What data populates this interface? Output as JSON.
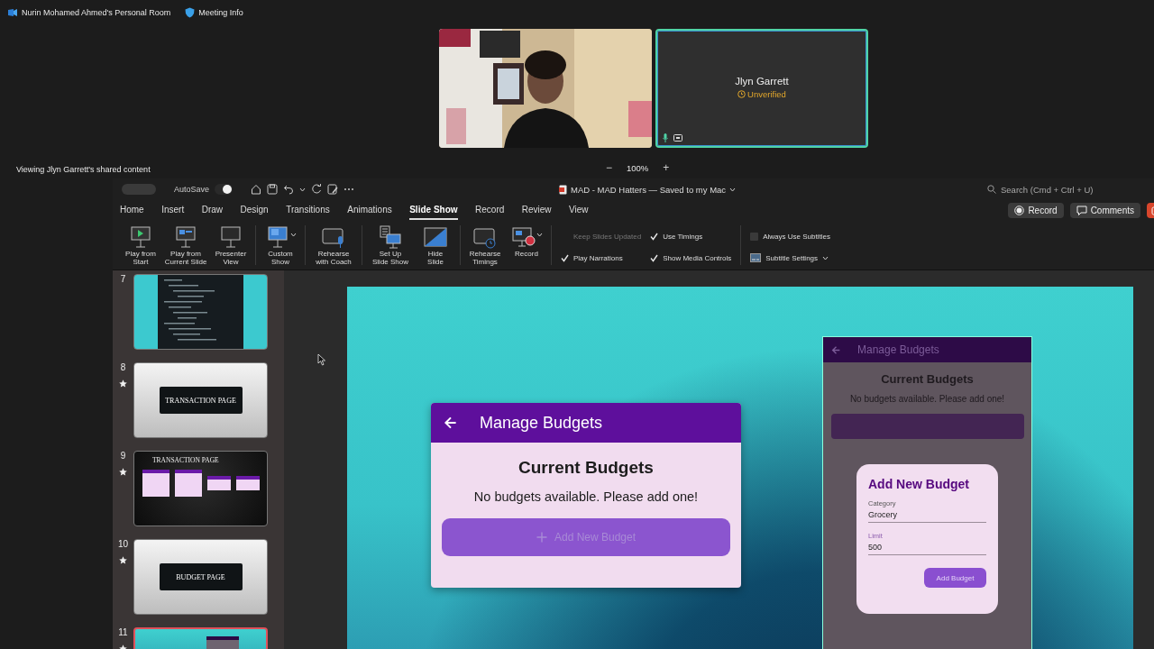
{
  "meeting": {
    "room": "Nurin Mohamed Ahmed's Personal Room",
    "info": "Meeting Info"
  },
  "participants": [
    {
      "kind": "video",
      "speaking": false
    },
    {
      "kind": "tile",
      "name": "Jlyn Garrett",
      "status": "Unverified",
      "speaking": true
    }
  ],
  "share_banner": "Viewing Jlyn Garrett's shared content",
  "zoom": {
    "minus": "−",
    "value": "100%",
    "plus": "+"
  },
  "app": {
    "autosave": {
      "label": "AutoSave",
      "on": true
    },
    "document_title": "MAD - MAD Hatters — Saved to my Mac",
    "search_placeholder": "Search (Cmd + Ctrl + U)",
    "tabs": [
      {
        "label": "Home",
        "selected": false
      },
      {
        "label": "Insert",
        "selected": false
      },
      {
        "label": "Draw",
        "selected": false
      },
      {
        "label": "Design",
        "selected": false
      },
      {
        "label": "Transitions",
        "selected": false
      },
      {
        "label": "Animations",
        "selected": false
      },
      {
        "label": "Slide Show",
        "selected": true
      },
      {
        "label": "Record",
        "selected": false
      },
      {
        "label": "Review",
        "selected": false
      },
      {
        "label": "View",
        "selected": false
      }
    ],
    "header_buttons": [
      {
        "kind": "record",
        "label": "Record"
      },
      {
        "kind": "comments",
        "label": "Comments"
      },
      {
        "kind": "share"
      }
    ],
    "ribbon": {
      "groups": [
        {
          "buttons": [
            {
              "kind": "play_start",
              "label": "Play from\nStart",
              "dropdown": false
            },
            {
              "kind": "play_current",
              "label": "Play from\nCurrent Slide",
              "dropdown": false
            },
            {
              "kind": "presenter",
              "label": "Presenter\nView",
              "dropdown": false
            }
          ]
        },
        {
          "buttons": [
            {
              "kind": "custom_show",
              "label": "Custom\nShow",
              "dropdown": true
            }
          ]
        },
        {
          "buttons": [
            {
              "kind": "coach",
              "label": "Rehearse\nwith Coach",
              "dropdown": false
            }
          ]
        },
        {
          "buttons": [
            {
              "kind": "setup",
              "label": "Set Up\nSlide Show",
              "dropdown": false
            },
            {
              "kind": "hide",
              "label": "Hide\nSlide",
              "dropdown": false
            }
          ]
        },
        {
          "buttons": [
            {
              "kind": "timings",
              "label": "Rehearse\nTimings",
              "dropdown": false
            },
            {
              "kind": "record",
              "label": "Record",
              "dropdown": true
            }
          ]
        }
      ],
      "options": [
        {
          "kind": "check",
          "label": "Keep Slides Updated",
          "checked": false,
          "disabled": true
        },
        {
          "kind": "check",
          "label": "Play Narrations",
          "checked": true,
          "disabled": false
        },
        {
          "kind": "check",
          "label": "Use Timings",
          "checked": true,
          "disabled": false
        },
        {
          "kind": "check",
          "label": "Show Media Controls",
          "checked": true,
          "disabled": false
        }
      ],
      "subtitles": {
        "always": {
          "label": "Always Use Subtitles",
          "checked": false
        },
        "settings": "Subtitle Settings"
      }
    }
  },
  "slides": [
    {
      "number": "7",
      "kind": "code",
      "starred": false,
      "selected": false
    },
    {
      "number": "8",
      "kind": "title",
      "title": "TRANSACTION PAGE",
      "starred": true,
      "selected": false
    },
    {
      "number": "9",
      "kind": "screens",
      "title": "TRANSACTION PAGE",
      "starred": true,
      "selected": false
    },
    {
      "number": "10",
      "kind": "title",
      "title": "BUDGET PAGE",
      "starred": true,
      "selected": false
    },
    {
      "number": "11",
      "kind": "app",
      "starred": true,
      "selected": true
    }
  ],
  "slide": {
    "main_card": {
      "title": "Manage Budgets",
      "heading": "Current Budgets",
      "message": "No budgets available. Please add one!",
      "button": "Add New Budget"
    },
    "preview": {
      "title": "Manage Budgets",
      "heading": "Current Budgets",
      "message": "No budgets available. Please add one!",
      "dialog": {
        "title": "Add New Budget",
        "fields": [
          {
            "label": "Category",
            "value": "Grocery"
          },
          {
            "label": "Limit",
            "value": "500"
          }
        ],
        "button": "Add Budget"
      }
    }
  }
}
